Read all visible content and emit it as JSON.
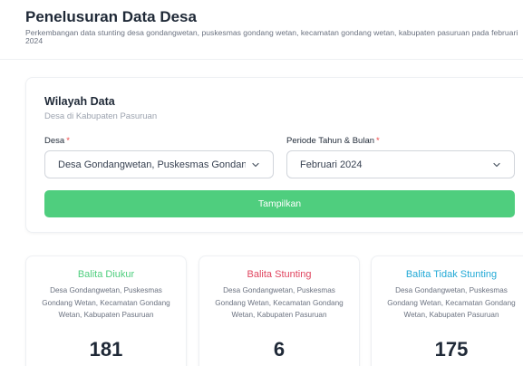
{
  "header": {
    "title": "Penelusuran Data Desa",
    "subtitle": "Perkembangan data stunting desa gondangwetan, puskesmas gondang wetan, kecamatan gondang wetan, kabupaten pasuruan pada februari 2024"
  },
  "filter_card": {
    "title": "Wilayah Data",
    "subtitle": "Desa di Kabupaten Pasuruan",
    "desa_label": "Desa",
    "desa_value": "Desa Gondangwetan, Puskesmas Gondan...",
    "periode_label": "Periode Tahun & Bulan",
    "periode_value": "Februari 2024",
    "required_mark": "*",
    "submit_label": "Tampilkan"
  },
  "stats": [
    {
      "title": "Balita Diukur",
      "color": "#4fce7e",
      "description": "Desa Gondangwetan, Puskesmas Gondang Wetan, Kecamatan Gondang Wetan, Kabupaten Pasuruan",
      "value": "181"
    },
    {
      "title": "Balita Stunting",
      "color": "#e0455f",
      "description": "Desa Gondangwetan, Puskesmas Gondang Wetan, Kecamatan Gondang Wetan, Kabupaten Pasuruan",
      "value": "6"
    },
    {
      "title": "Balita Tidak Stunting",
      "color": "#22a9d6",
      "description": "Desa Gondangwetan, Puskesmas Gondang Wetan, Kecamatan Gondang Wetan, Kabupaten Pasuruan",
      "value": "175"
    }
  ],
  "icons": {
    "select_chevron": "chevron-down-icon"
  }
}
